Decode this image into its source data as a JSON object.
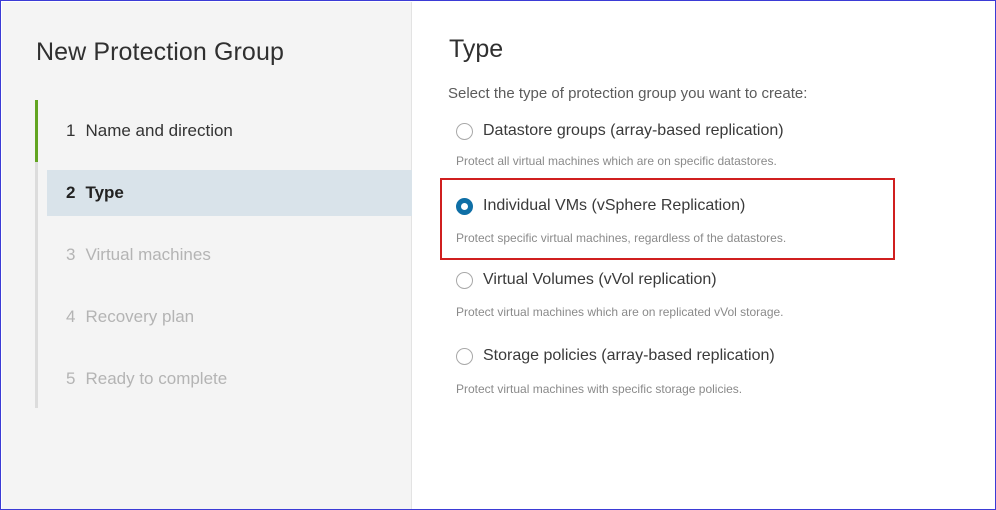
{
  "wizard": {
    "title": "New Protection Group",
    "steps": [
      {
        "num": "1",
        "label": "Name and direction",
        "state": "done"
      },
      {
        "num": "2",
        "label": "Type",
        "state": "current"
      },
      {
        "num": "3",
        "label": "Virtual machines",
        "state": "future"
      },
      {
        "num": "4",
        "label": "Recovery plan",
        "state": "future"
      },
      {
        "num": "5",
        "label": "Ready to complete",
        "state": "future"
      }
    ]
  },
  "page": {
    "title": "Type",
    "instruction": "Select the type of protection group you want to create:",
    "options": [
      {
        "label": "Datastore groups (array-based replication)",
        "description": "Protect all virtual machines which are on specific datastores.",
        "selected": false
      },
      {
        "label": "Individual VMs (vSphere Replication)",
        "description": "Protect specific virtual machines, regardless of the datastores.",
        "selected": true
      },
      {
        "label": "Virtual Volumes (vVol replication)",
        "description": "Protect virtual machines which are on replicated vVol storage.",
        "selected": false
      },
      {
        "label": "Storage policies (array-based replication)",
        "description": "Protect virtual machines with specific storage policies.",
        "selected": false
      }
    ]
  },
  "colors": {
    "frame_border": "#3b3bd6",
    "completed_step_bar": "#62a420",
    "current_step_bg": "#d9e3ea",
    "radio_selected": "#0f6fa6",
    "highlight_box": "#d01f1f"
  }
}
